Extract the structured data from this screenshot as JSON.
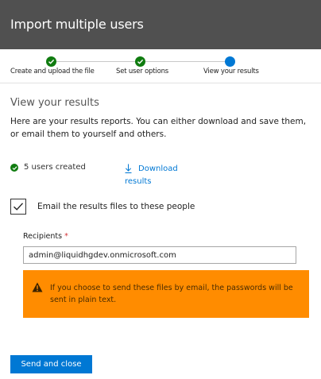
{
  "header": {
    "title": "Import multiple users"
  },
  "stepper": {
    "steps": [
      {
        "label": "Create and upload the file",
        "status": "completed",
        "icon": "checkmark-icon"
      },
      {
        "label": "Set user options",
        "status": "completed",
        "icon": "checkmark-icon"
      },
      {
        "label": "View your results",
        "status": "current"
      }
    ]
  },
  "main": {
    "section_title": "View your results",
    "description": "Here are your results reports. You can either download and save them, or email them to yourself and others.",
    "status_text": "5 users created",
    "download_link": {
      "line1": "Download",
      "line2": "results",
      "icon": "download-arrow-icon"
    },
    "email_checkbox": {
      "label": "Email the results files to these people",
      "checked": true
    },
    "recipients": {
      "label": "Recipients",
      "required_mark": "*",
      "value": "admin@liquidhgdev.onmicrosoft.com"
    },
    "warning": {
      "icon": "warning-triangle-icon",
      "text": "If you choose to send these files by email, the passwords will be sent in plain text."
    },
    "send_button_label": "Send and close"
  },
  "colors": {
    "header_bg": "#505050",
    "success_green": "#107c10",
    "accent_blue": "#0078d4",
    "warning_orange": "#ff8c00"
  }
}
